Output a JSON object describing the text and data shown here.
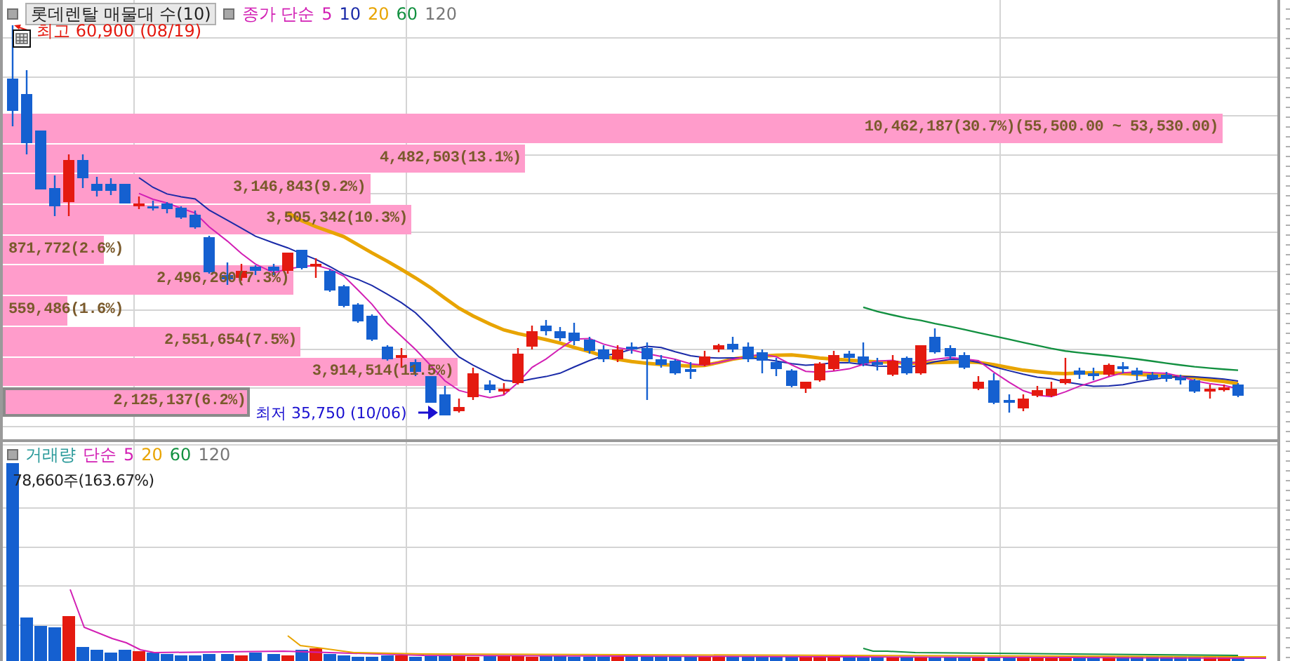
{
  "price_panel": {
    "title": "롯데렌탈 매물대 수(10)",
    "legend": [
      {
        "label": "종가 단순",
        "color": "#d21fb4"
      },
      {
        "label": "5",
        "color": "#d21fb4"
      },
      {
        "label": "10",
        "color": "#1a2aa8"
      },
      {
        "label": "20",
        "color": "#e8a400"
      },
      {
        "label": "60",
        "color": "#129040"
      },
      {
        "label": "120",
        "color": "#777777"
      }
    ],
    "high_marker": {
      "label": "최고 60,900 (08/19)"
    },
    "low_marker": {
      "label": "최저 35,750 (10/06)"
    },
    "volume_profile": [
      {
        "label": "10,462,187(30.7%)(55,500.00 ~ 53,530.00)",
        "level": 0.957,
        "current": false
      },
      {
        "label": "4,482,503(13.1%)",
        "level": 0.41,
        "current": false
      },
      {
        "label": "3,146,843(9.2%)",
        "level": 0.288,
        "current": false
      },
      {
        "label": "3,505,342(10.3%)",
        "level": 0.321,
        "current": false
      },
      {
        "label": "871,772(2.6%)",
        "level": 0.079,
        "current": false
      },
      {
        "label": "2,496,260(7.3%)",
        "level": 0.228,
        "current": false
      },
      {
        "label": "559,486(1.6%)",
        "level": 0.051,
        "current": false
      },
      {
        "label": "2,551,654(7.5%)",
        "level": 0.234,
        "current": false
      },
      {
        "label": "3,914,514(11.5%)",
        "level": 0.357,
        "current": false
      },
      {
        "label": "2,125,137(6.2%)",
        "level": 0.194,
        "current": true
      }
    ]
  },
  "volume_panel": {
    "legend": [
      {
        "label": "거래량",
        "color": "#2a9a9a"
      },
      {
        "label": "단순",
        "color": "#d21fb4"
      },
      {
        "label": "5",
        "color": "#d21fb4"
      },
      {
        "label": "20",
        "color": "#e8a400"
      },
      {
        "label": "60",
        "color": "#129040"
      },
      {
        "label": "120",
        "color": "#777777"
      }
    ],
    "reading": "78,660주(163.67%)"
  }
}
